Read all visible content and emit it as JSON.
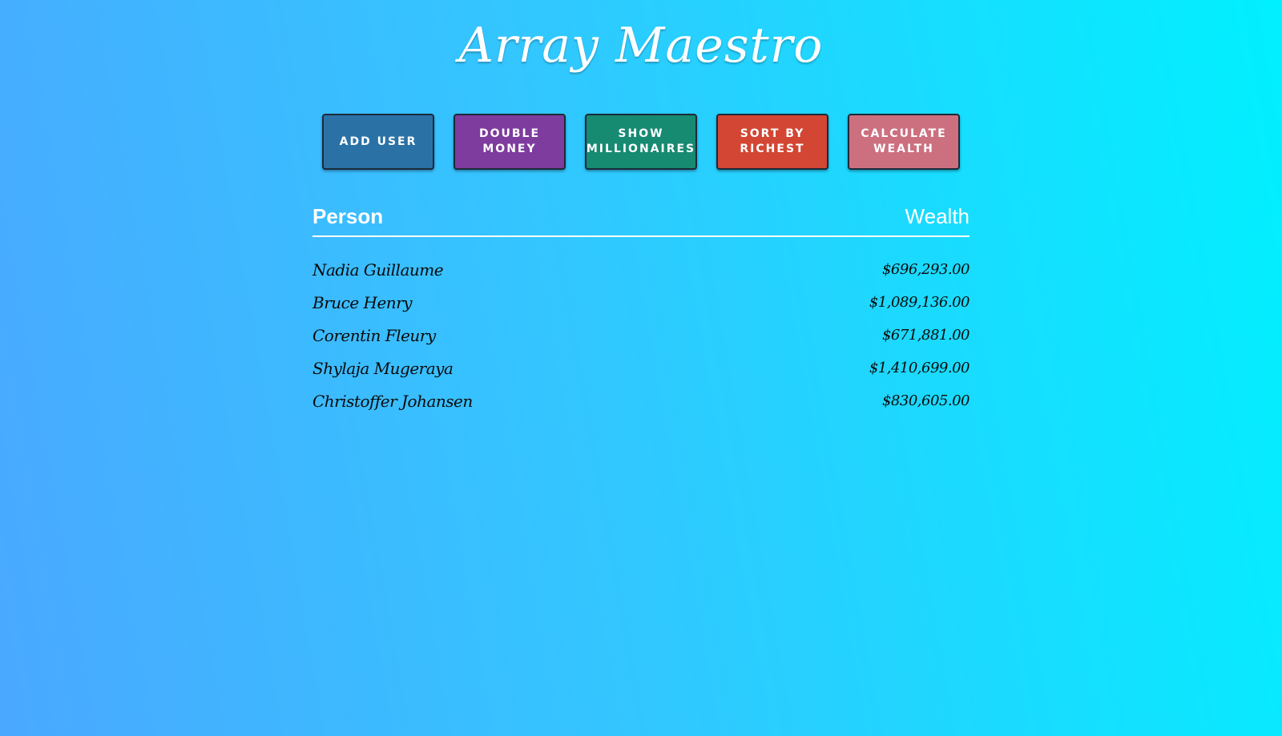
{
  "app": {
    "title": "Array Maestro"
  },
  "toolbar": {
    "buttons": [
      {
        "label": "ADD USER",
        "color": "#2a72a6"
      },
      {
        "label": "DOUBLE MONEY",
        "color": "#7d3c9e"
      },
      {
        "label": "SHOW MILLIONAIRES",
        "color": "#178a72"
      },
      {
        "label": "SORT BY RICHEST",
        "color": "#d24633"
      },
      {
        "label": "CALCULATE WEALTH",
        "color": "#cc7080"
      }
    ]
  },
  "table": {
    "headers": {
      "person": "Person",
      "wealth": "Wealth"
    },
    "rows": [
      {
        "name": "Nadia Guillaume",
        "wealth": "$696,293.00"
      },
      {
        "name": "Bruce Henry",
        "wealth": "$1,089,136.00"
      },
      {
        "name": "Corentin Fleury",
        "wealth": "$671,881.00"
      },
      {
        "name": "Shylaja Mugeraya",
        "wealth": "$1,410,699.00"
      },
      {
        "name": "Christoffer Johansen",
        "wealth": "$830,605.00"
      }
    ]
  },
  "colors": {
    "background_start": "#4aa8ff",
    "background_end": "#00f0ff",
    "text_light": "#ffffff",
    "text_dark": "#0a0a0a"
  }
}
